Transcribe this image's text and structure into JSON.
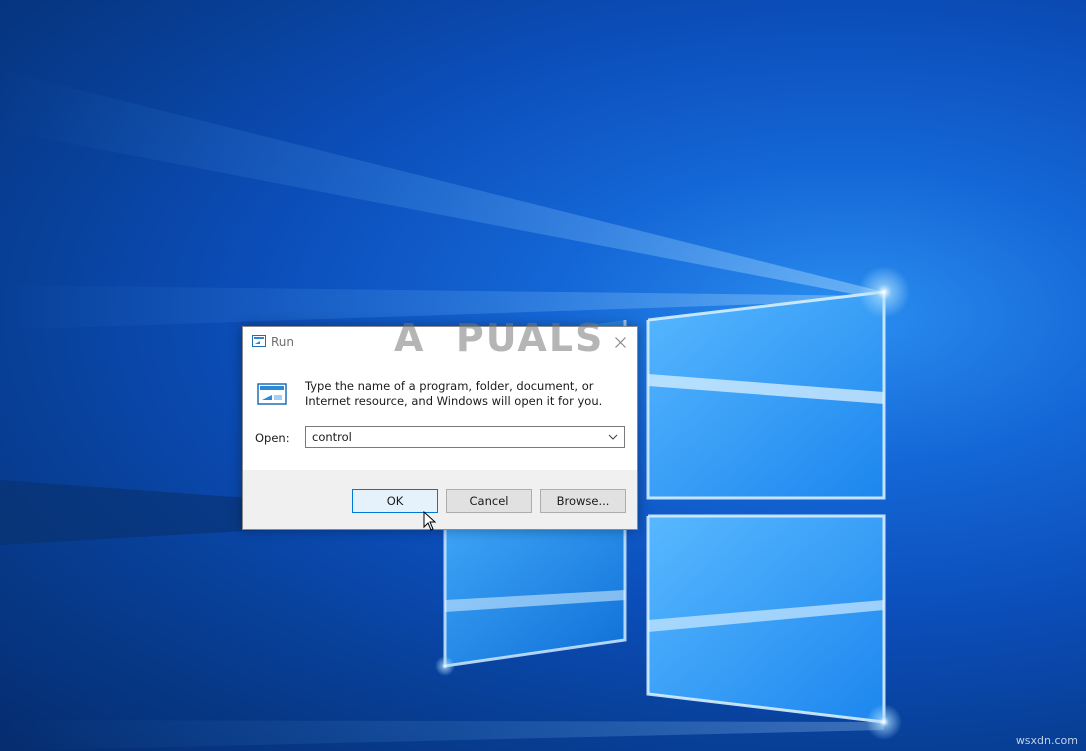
{
  "run_dialog": {
    "title": "Run",
    "description": "Type the name of a program, folder, document, or Internet resource, and Windows will open it for you.",
    "open_label": "Open:",
    "open_value": "control",
    "close_icon": "close-icon",
    "dropdown_icon": "chevron-down-icon",
    "buttons": {
      "ok": "OK",
      "cancel": "Cancel",
      "browse": "Browse..."
    }
  },
  "watermark": {
    "brand": "APPUALS",
    "site": "wsxdn.com"
  },
  "colors": {
    "desktop_blue": "#0b4db8",
    "window_pane": "#3aa6f5",
    "button_face": "#e1e1e1",
    "button_bar": "#f0f0f0",
    "focus_border": "#0078d7"
  }
}
